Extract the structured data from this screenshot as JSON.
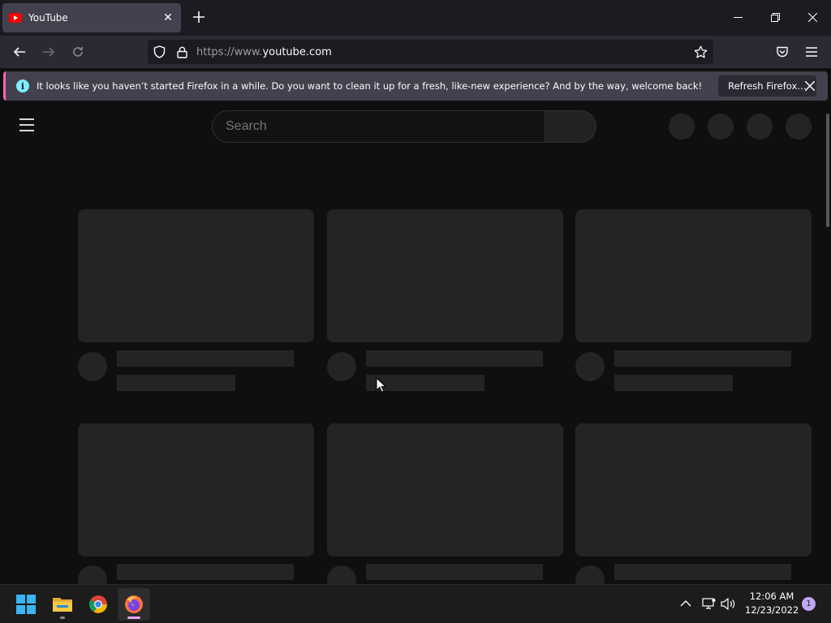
{
  "browser": {
    "tab": {
      "title": "YouTube",
      "favicon": "youtube-icon"
    },
    "url": {
      "scheme_prefix": "https://www.",
      "host": "youtube.com"
    }
  },
  "notification": {
    "icon": "info-icon",
    "message": "It looks like you haven’t started Firefox in a while. Do you want to clean it up for a fresh, like-new experience? And by the way, welcome back!",
    "button_label": "Refresh Firefox…",
    "accent_color": "#ff65b8"
  },
  "youtube": {
    "search_placeholder": "Search",
    "skeleton_rows": 2,
    "skeleton_columns": 3
  },
  "taskbar": {
    "apps": [
      "start-icon",
      "file-explorer-icon",
      "chrome-icon",
      "firefox-icon"
    ],
    "clock_time": "12:06 AM",
    "clock_date": "12/23/2022",
    "notification_count": "1"
  }
}
